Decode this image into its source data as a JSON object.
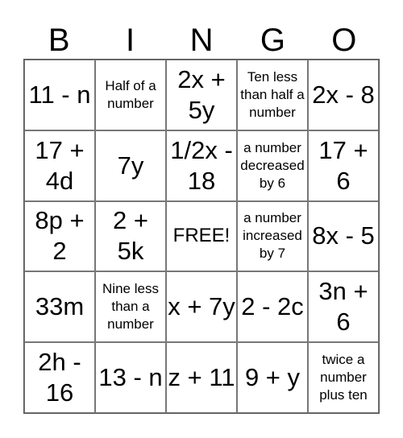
{
  "header": [
    "B",
    "I",
    "N",
    "G",
    "O"
  ],
  "cells": [
    {
      "text": "11 - n",
      "size": "big"
    },
    {
      "text": "Half of a number",
      "size": "small"
    },
    {
      "text": "2x + 5y",
      "size": "big"
    },
    {
      "text": "Ten less than half a number",
      "size": "small"
    },
    {
      "text": "2x - 8",
      "size": "big"
    },
    {
      "text": "17 + 4d",
      "size": "big"
    },
    {
      "text": "7y",
      "size": "big"
    },
    {
      "text": "1/2x - 18",
      "size": "big"
    },
    {
      "text": "a number decreased by 6",
      "size": "small"
    },
    {
      "text": "17 + 6",
      "size": "big"
    },
    {
      "text": "8p + 2",
      "size": "big"
    },
    {
      "text": "2 + 5k",
      "size": "big"
    },
    {
      "text": "FREE!",
      "size": "free"
    },
    {
      "text": "a number increased by 7",
      "size": "small"
    },
    {
      "text": "8x - 5",
      "size": "big"
    },
    {
      "text": "33m",
      "size": "big"
    },
    {
      "text": "Nine less than a number",
      "size": "small"
    },
    {
      "text": "x + 7y",
      "size": "big"
    },
    {
      "text": "2 - 2c",
      "size": "big"
    },
    {
      "text": "3n + 6",
      "size": "big"
    },
    {
      "text": "2h - 16",
      "size": "big"
    },
    {
      "text": "13 - n",
      "size": "big"
    },
    {
      "text": "z + 11",
      "size": "big"
    },
    {
      "text": "9 + y",
      "size": "big"
    },
    {
      "text": "twice a number plus ten",
      "size": "small"
    }
  ]
}
